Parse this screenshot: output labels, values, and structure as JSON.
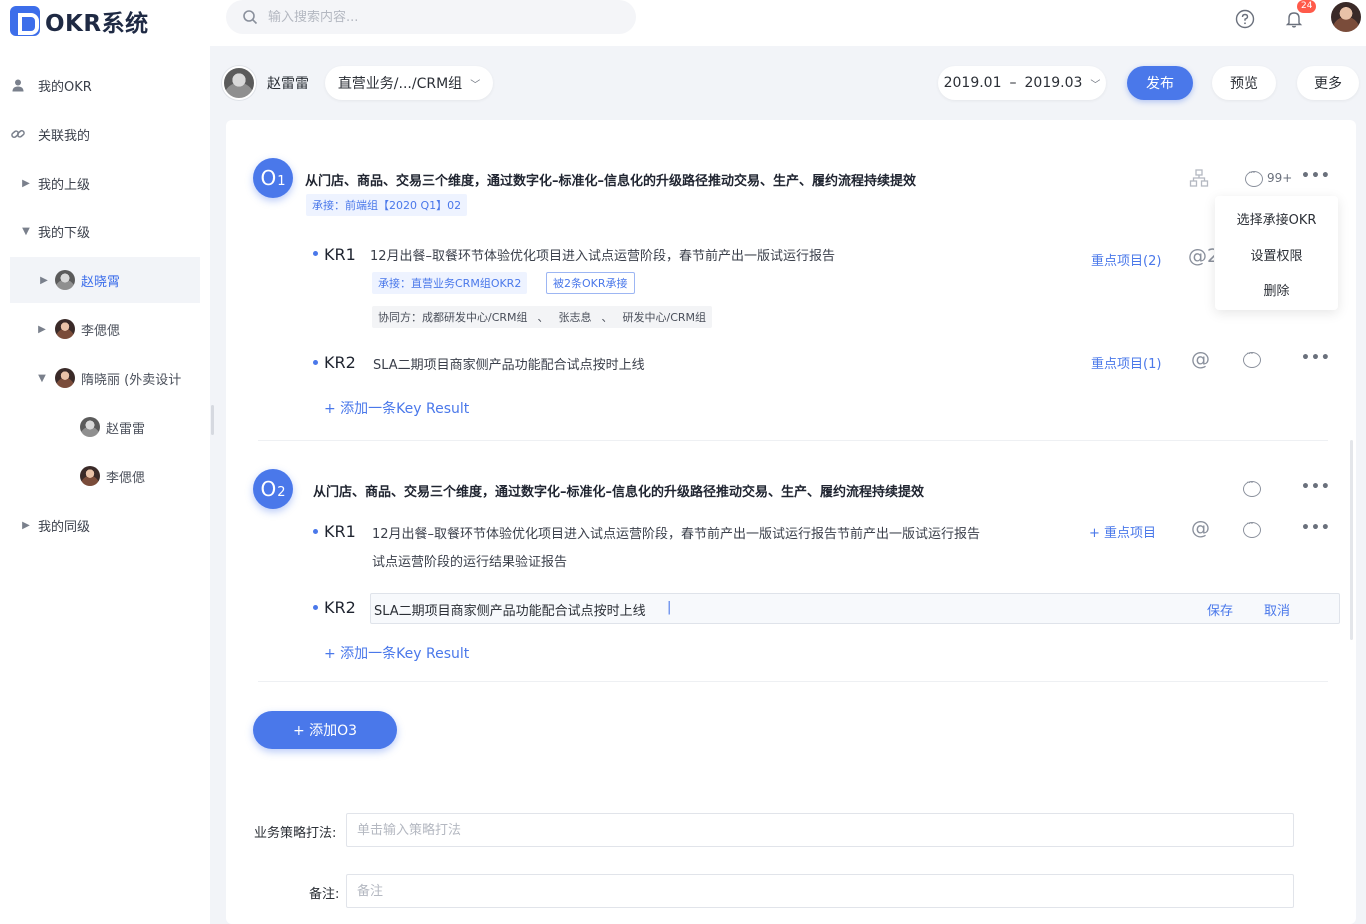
{
  "app": {
    "logo_text": "OKR系统",
    "brand_color": "#3d6eea"
  },
  "search": {
    "placeholder": "输入搜索内容..."
  },
  "topbar": {
    "notification_count": "24"
  },
  "sidebar": {
    "items": [
      {
        "label": "我的OKR",
        "icon": "user-icon"
      },
      {
        "label": "关联我的",
        "icon": "link-icon"
      },
      {
        "label": "我的上级",
        "icon": "caret-right-icon"
      },
      {
        "label": "我的下级",
        "icon": "caret-down-icon"
      },
      {
        "label": "我的同级",
        "icon": "caret-right-icon"
      }
    ],
    "subordinates": [
      {
        "label": "赵晓霄"
      },
      {
        "label": "李偲偲"
      },
      {
        "label": "隋晓丽 (外卖设计"
      },
      {
        "label": "赵雷雷"
      },
      {
        "label": "李偲偲"
      }
    ]
  },
  "header": {
    "user_name": "赵雷雷",
    "department": "直营业务/.../CRM组",
    "date_start": "2019.01",
    "date_sep": "–",
    "date_end": "2019.03",
    "publish": "发布",
    "preview": "预览",
    "more": "更多"
  },
  "objectives": [
    {
      "badge": "O",
      "num": "1",
      "title": "从门店、商品、交易三个维度，通过数字化–标准化–信息化的升级路径推动交易、生产、履约流程持续提效",
      "inherit_tag": "承接：前端组【2020 Q1】02",
      "comment_count": "99+",
      "krs": [
        {
          "label": "KR1",
          "text": "12月出餐–取餐环节体验优化项目进入试点运营阶段，春节前产出一版试运行报告",
          "inherit_tag": "承接：直营业务CRM组OKR2",
          "adopted_tag": "被2条OKR承接",
          "collab_prefix": "协同方：",
          "collaborators": [
            "成都研发中心/CRM组",
            "张志息",
            "研发中心/CRM组"
          ],
          "collab_sep": "、",
          "project_link": "重点项目(2)",
          "at_label": "@2"
        },
        {
          "label": "KR2",
          "text": "SLA二期项目商家侧产品功能配合试点按时上线",
          "project_link": "重点项目(1)",
          "at_label": "@"
        }
      ],
      "add_kr": "+ 添加一条Key Result"
    },
    {
      "badge": "O",
      "num": "2",
      "title": "从门店、商品、交易三个维度，通过数字化–标准化–信息化的升级路径推动交易、生产、履约流程持续提效",
      "krs": [
        {
          "label": "KR1",
          "text_line1": "12月出餐–取餐环节体验优化项目进入试点运营阶段，春节前产出一版试运行报告节前产出一版试运行报告",
          "text_line2": "试点运营阶段的运行结果验证报告",
          "project_link": "+ 重点项目",
          "at_label": "@"
        },
        {
          "label": "KR2",
          "edit_value": "SLA二期项目商家侧产品功能配合试点按时上线",
          "save": "保存",
          "cancel": "取消"
        }
      ],
      "add_kr": "+ 添加一条Key Result"
    }
  ],
  "dropdown_menu": [
    "选择承接OKR",
    "设置权限",
    "删除"
  ],
  "add_objective": "+ 添加O3",
  "form": {
    "strategy_label": "业务策略打法:",
    "strategy_placeholder": "单击输入策略打法",
    "note_label": "备注:",
    "note_placeholder": "备注"
  }
}
